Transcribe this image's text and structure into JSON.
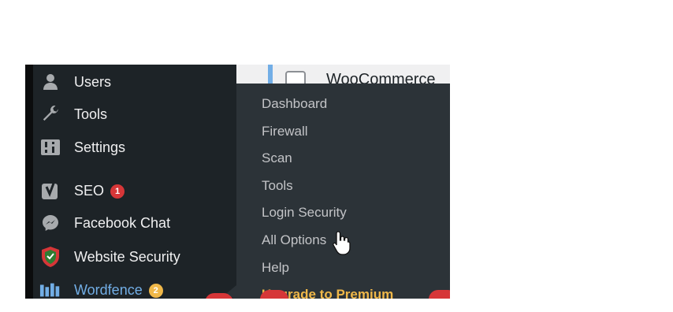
{
  "sidebar": {
    "items": [
      {
        "label": "Users",
        "icon": "user-icon"
      },
      {
        "label": "Tools",
        "icon": "wrench-icon"
      },
      {
        "label": "Settings",
        "icon": "settings-icon"
      },
      {
        "label": "SEO",
        "icon": "yoast-icon",
        "badge": "1",
        "badge_color": "#d63638"
      },
      {
        "label": "Facebook Chat",
        "icon": "messenger-icon"
      },
      {
        "label": "Website Security",
        "icon": "shield-icon"
      },
      {
        "label": "Wordfence",
        "icon": "wordfence-icon",
        "badge": "2",
        "badge_color": "#f0b849",
        "active": true
      }
    ]
  },
  "content": {
    "row_text": "WooCommerce"
  },
  "submenu": {
    "items": [
      {
        "label": "Dashboard"
      },
      {
        "label": "Firewall"
      },
      {
        "label": "Scan"
      },
      {
        "label": "Tools"
      },
      {
        "label": "Login Security"
      },
      {
        "label": "All Options"
      },
      {
        "label": "Help"
      },
      {
        "label": "Upgrade to Premium"
      }
    ]
  },
  "colors": {
    "sidebar_bg": "#1d2327",
    "submenu_bg": "#2c3338",
    "active_text": "#72aee6",
    "upgrade_text": "#f0b849",
    "badge_red": "#d63638"
  }
}
